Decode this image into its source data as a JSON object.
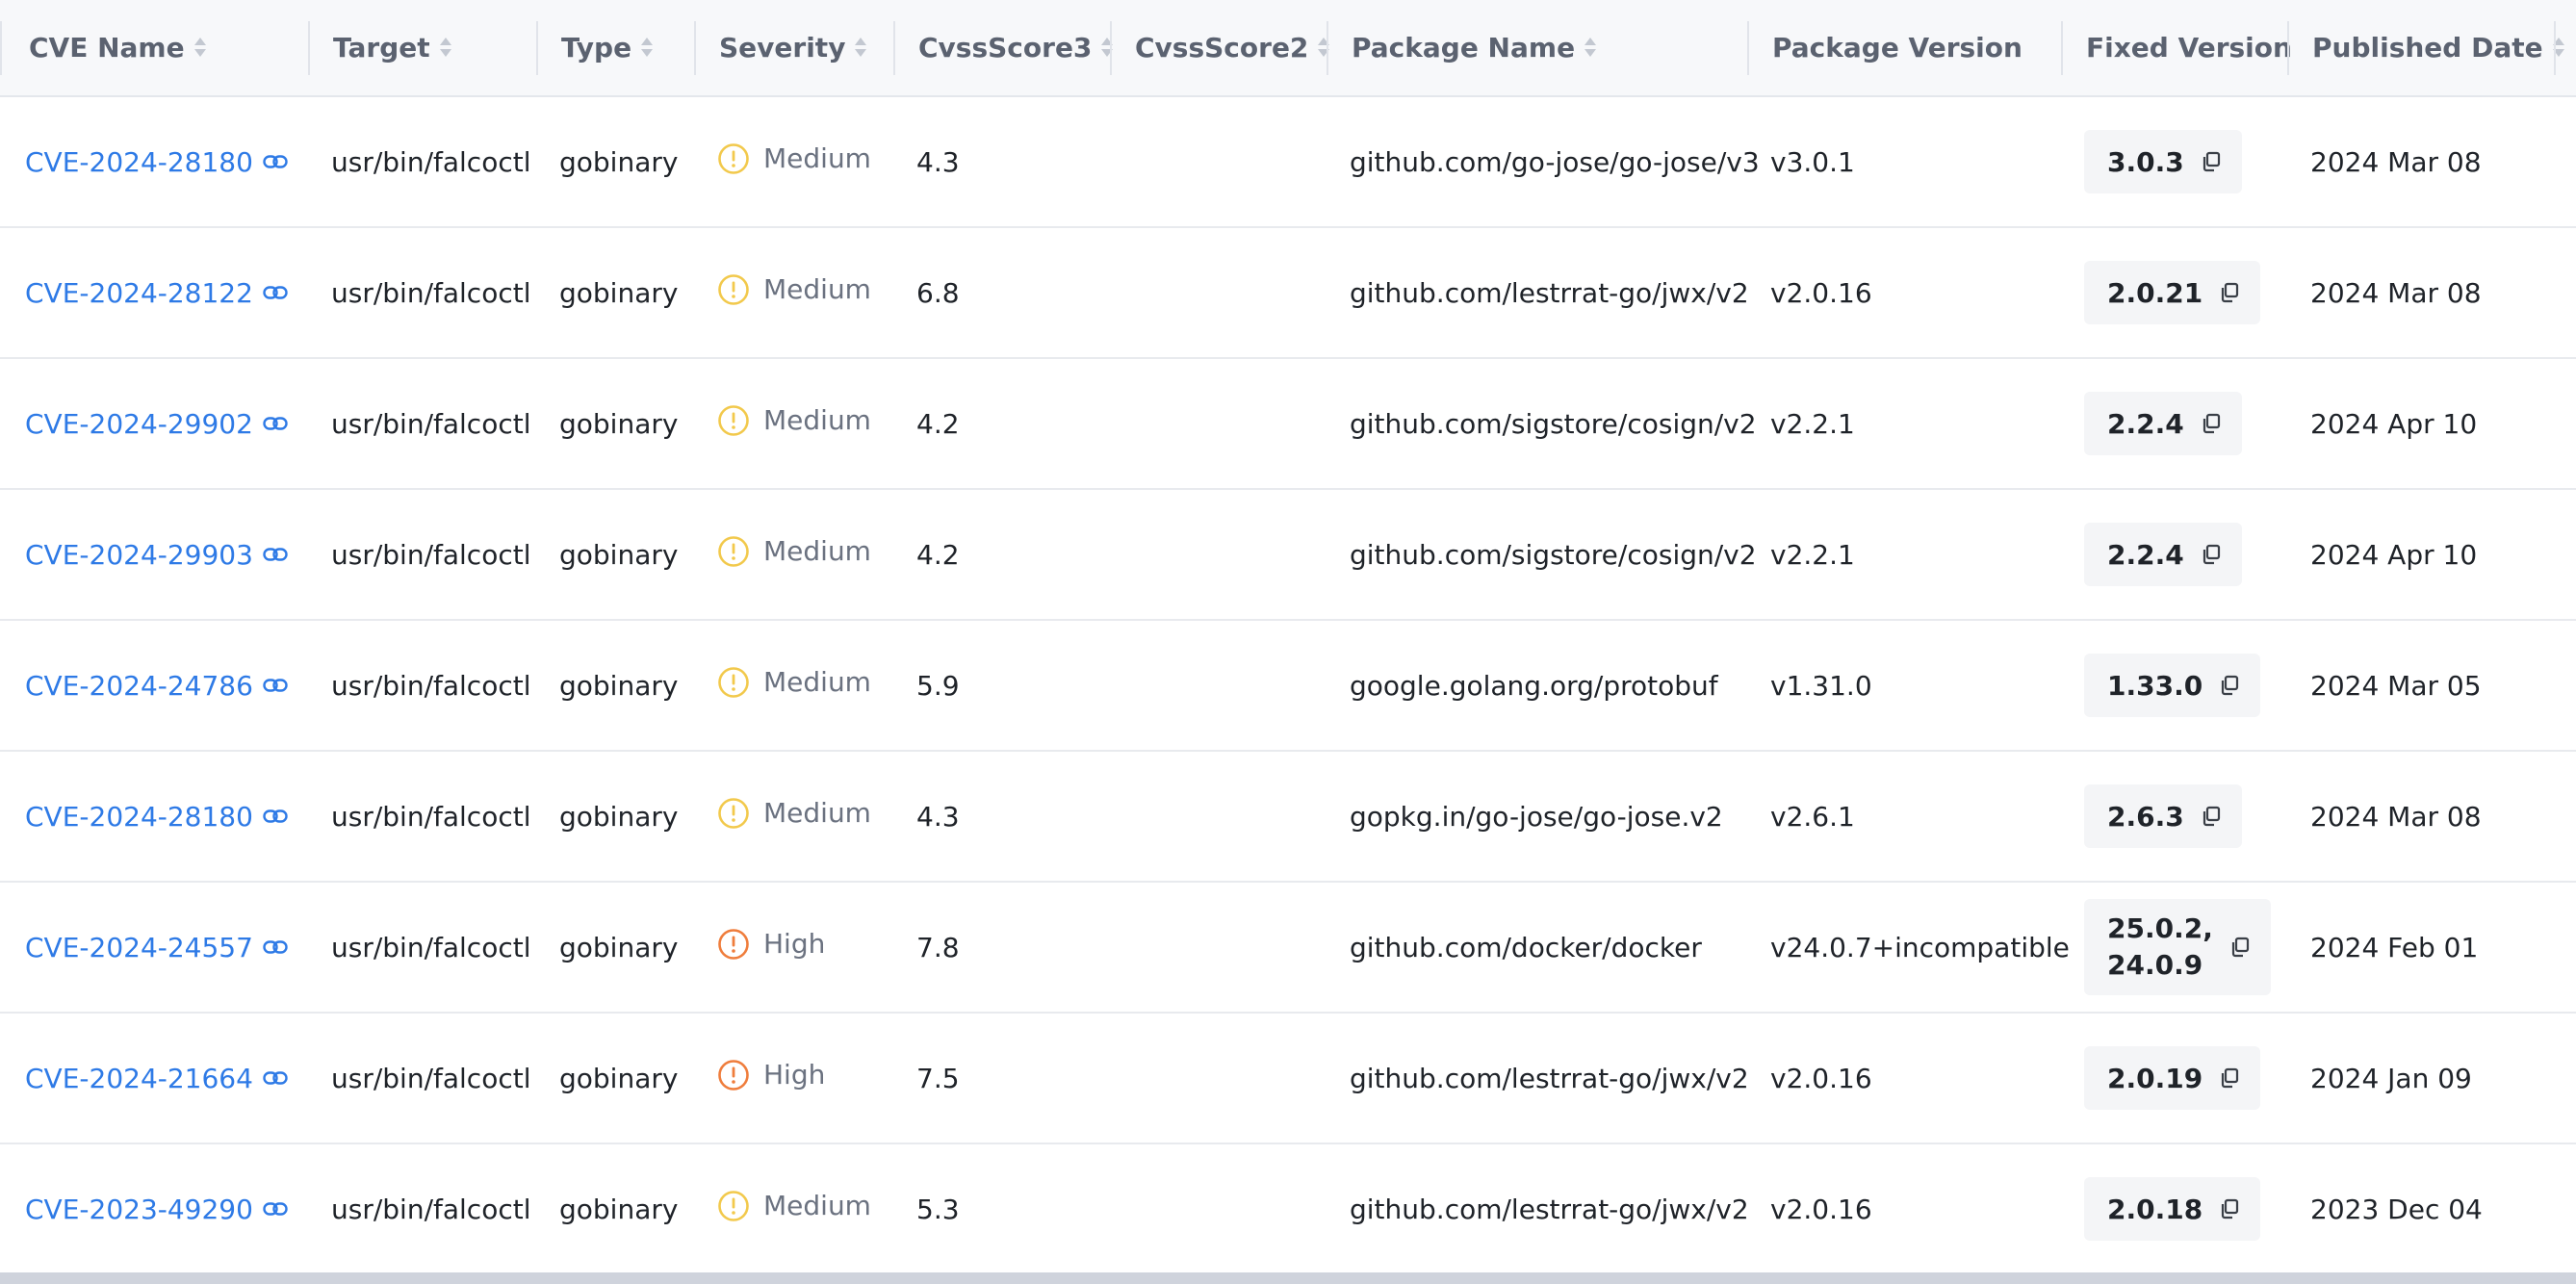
{
  "columns": {
    "cve_name": "CVE Name",
    "target": "Target",
    "type": "Type",
    "severity": "Severity",
    "cvss3": "CvssScore3",
    "cvss2": "CvssScore2",
    "package_name": "Package Name",
    "package_version": "Package Version",
    "fixed_version": "Fixed Version",
    "published_date": "Published Date"
  },
  "severity_colors": {
    "Medium": "#f2c94c",
    "High": "#ef7d3c"
  },
  "link_color": "#2e7ae6",
  "rows": [
    {
      "cve": "CVE-2024-28180",
      "target": "usr/bin/falcoctl",
      "type": "gobinary",
      "severity": "Medium",
      "cvss3": "4.3",
      "cvss2": "",
      "package": "github.com/go-jose/go-jose/v3",
      "version": "v3.0.1",
      "fixed": "3.0.3",
      "published": "2024 Mar 08"
    },
    {
      "cve": "CVE-2024-28122",
      "target": "usr/bin/falcoctl",
      "type": "gobinary",
      "severity": "Medium",
      "cvss3": "6.8",
      "cvss2": "",
      "package": "github.com/lestrrat-go/jwx/v2",
      "version": "v2.0.16",
      "fixed": "2.0.21",
      "published": "2024 Mar 08"
    },
    {
      "cve": "CVE-2024-29902",
      "target": "usr/bin/falcoctl",
      "type": "gobinary",
      "severity": "Medium",
      "cvss3": "4.2",
      "cvss2": "",
      "package": "github.com/sigstore/cosign/v2",
      "version": "v2.2.1",
      "fixed": "2.2.4",
      "published": "2024 Apr 10"
    },
    {
      "cve": "CVE-2024-29903",
      "target": "usr/bin/falcoctl",
      "type": "gobinary",
      "severity": "Medium",
      "cvss3": "4.2",
      "cvss2": "",
      "package": "github.com/sigstore/cosign/v2",
      "version": "v2.2.1",
      "fixed": "2.2.4",
      "published": "2024 Apr 10"
    },
    {
      "cve": "CVE-2024-24786",
      "target": "usr/bin/falcoctl",
      "type": "gobinary",
      "severity": "Medium",
      "cvss3": "5.9",
      "cvss2": "",
      "package": "google.golang.org/protobuf",
      "version": "v1.31.0",
      "fixed": "1.33.0",
      "published": "2024 Mar 05"
    },
    {
      "cve": "CVE-2024-28180",
      "target": "usr/bin/falcoctl",
      "type": "gobinary",
      "severity": "Medium",
      "cvss3": "4.3",
      "cvss2": "",
      "package": "gopkg.in/go-jose/go-jose.v2",
      "version": "v2.6.1",
      "fixed": "2.6.3",
      "published": "2024 Mar 08"
    },
    {
      "cve": "CVE-2024-24557",
      "target": "usr/bin/falcoctl",
      "type": "gobinary",
      "severity": "High",
      "cvss3": "7.8",
      "cvss2": "",
      "package": "github.com/docker/docker",
      "version": "v24.0.7+incompatible",
      "fixed": "25.0.2,\n24.0.9",
      "published": "2024 Feb 01"
    },
    {
      "cve": "CVE-2024-21664",
      "target": "usr/bin/falcoctl",
      "type": "gobinary",
      "severity": "High",
      "cvss3": "7.5",
      "cvss2": "",
      "package": "github.com/lestrrat-go/jwx/v2",
      "version": "v2.0.16",
      "fixed": "2.0.19",
      "published": "2024 Jan 09"
    },
    {
      "cve": "CVE-2023-49290",
      "target": "usr/bin/falcoctl",
      "type": "gobinary",
      "severity": "Medium",
      "cvss3": "5.3",
      "cvss2": "",
      "package": "github.com/lestrrat-go/jwx/v2",
      "version": "v2.0.16",
      "fixed": "2.0.18",
      "published": "2023 Dec 04"
    }
  ]
}
